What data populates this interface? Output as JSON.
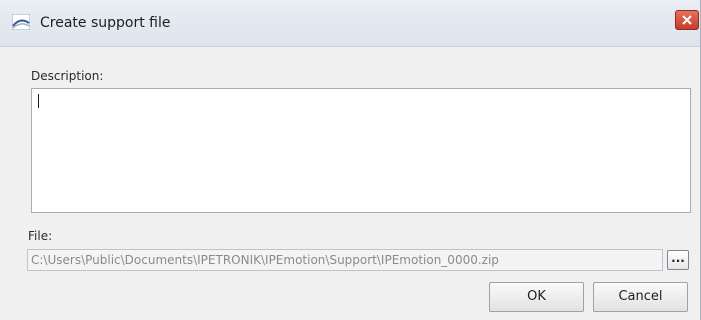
{
  "window": {
    "title": "Create support file",
    "icon": "app-logo-icon",
    "close_icon": "close-icon"
  },
  "description": {
    "label": "Description:",
    "value": ""
  },
  "file": {
    "label": "File:",
    "path": "C:\\Users\\Public\\Documents\\IPETRONIK\\IPEmotion\\Support\\IPEmotion_0000.zip",
    "browse_label": "..."
  },
  "buttons": {
    "ok": "OK",
    "cancel": "Cancel"
  },
  "colors": {
    "close_button": "#c43d2a",
    "dialog_background": "#f0f0f0",
    "titlebar": "#dde4ec"
  }
}
